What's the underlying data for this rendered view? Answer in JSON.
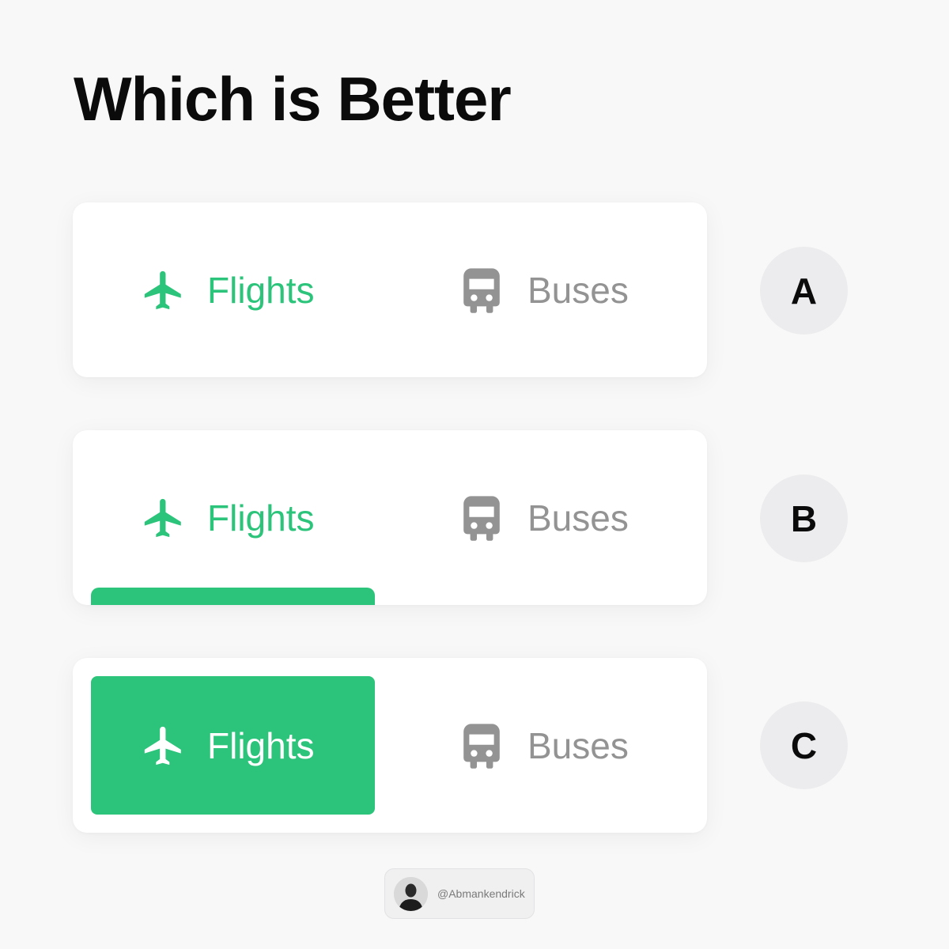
{
  "title": "Which is Better",
  "accent_color": "#2bc47a",
  "inactive_color": "#939393",
  "options": [
    {
      "letter": "A",
      "style": "plain",
      "tabs": [
        {
          "label": "Flights",
          "icon": "airplane-icon",
          "active": true
        },
        {
          "label": "Buses",
          "icon": "bus-icon",
          "active": false
        }
      ]
    },
    {
      "letter": "B",
      "style": "underline",
      "tabs": [
        {
          "label": "Flights",
          "icon": "airplane-icon",
          "active": true
        },
        {
          "label": "Buses",
          "icon": "bus-icon",
          "active": false
        }
      ]
    },
    {
      "letter": "C",
      "style": "filled",
      "tabs": [
        {
          "label": "Flights",
          "icon": "airplane-icon",
          "active": true
        },
        {
          "label": "Buses",
          "icon": "bus-icon",
          "active": false
        }
      ]
    }
  ],
  "author": {
    "handle": "@Abmankendrick"
  }
}
